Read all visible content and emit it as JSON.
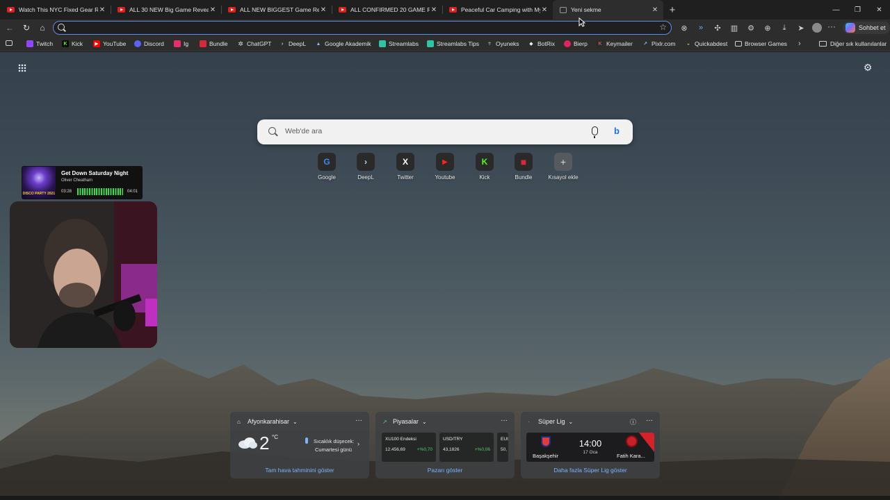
{
  "tabs": [
    {
      "title": "Watch This NYC Fixed Gear Rider C",
      "favicon": "youtube-icon"
    },
    {
      "title": "ALL 30 NEW Big Game Reveals fro",
      "favicon": "youtube-icon"
    },
    {
      "title": "ALL NEW BIGGEST Game Reveals o",
      "favicon": "youtube-icon"
    },
    {
      "title": "ALL CONFIRMED 20 GAME REMAK",
      "favicon": "youtube-icon"
    },
    {
      "title": "Peaceful Car Camping with My Do",
      "favicon": "youtube-icon"
    },
    {
      "title": "Yeni sekme",
      "favicon": "newtab-icon",
      "active": true
    }
  ],
  "toolbar": {
    "copilot_label": "Sohbet et"
  },
  "bookmarks": [
    {
      "label": "Twitch",
      "icon": "twitch-icon",
      "color": "#9146ff"
    },
    {
      "label": "Kick",
      "icon": "kick-icon",
      "color": "#53fc18"
    },
    {
      "label": "YouTube",
      "icon": "youtube-icon",
      "color": "#ff0000"
    },
    {
      "label": "Discord",
      "icon": "discord-icon",
      "color": "#5865f2"
    },
    {
      "label": "Ig",
      "icon": "instagram-icon",
      "color": "#e1306c"
    },
    {
      "label": "Bundle",
      "icon": "bundle-icon",
      "color": "#d62a3a"
    },
    {
      "label": "ChatGPT",
      "icon": "chatgpt-icon",
      "color": "#555555"
    },
    {
      "label": "DeepL",
      "icon": "deepl-icon",
      "color": "#0f2b46"
    },
    {
      "label": "Google Akademik",
      "icon": "scholar-icon",
      "color": "#4285f4"
    },
    {
      "label": "Streamlabs",
      "icon": "streamlabs-icon",
      "color": "#31c3a2"
    },
    {
      "label": "Streamlabs Tips",
      "icon": "streamlabs-icon",
      "color": "#31c3a2"
    },
    {
      "label": "Oyuneks",
      "icon": "oyuneks-icon",
      "color": "#888888"
    },
    {
      "label": "BotRix",
      "icon": "botrix-icon",
      "color": "#e6e6e6"
    },
    {
      "label": "Bierp",
      "icon": "bierp-icon",
      "color": "#e0245e"
    },
    {
      "label": "Keymailer",
      "icon": "keymailer-icon",
      "color": "#b0203a"
    },
    {
      "label": "Pixlr.com",
      "icon": "pixlr-icon",
      "color": "#3aa0ff"
    },
    {
      "label": "Quickabdest",
      "icon": "quickabdest-icon",
      "color": "#9acd32"
    },
    {
      "label": "Browser Games",
      "icon": "folder-icon",
      "color": "#cfcfcf"
    }
  ],
  "bookmarks_other": "Diğer sık kullanılanlar",
  "search": {
    "placeholder": "Web'de ara"
  },
  "quick_links": [
    {
      "label": "Google",
      "icon": "google-icon",
      "glyph": "G",
      "bg": "#2a2a2a",
      "fg": "#4285f4"
    },
    {
      "label": "DeepL",
      "icon": "deepl-icon",
      "glyph": ">",
      "bg": "#2a2a2a",
      "fg": "#cfd8e3"
    },
    {
      "label": "Twitter",
      "icon": "x-icon",
      "glyph": "X",
      "bg": "#2a2a2a",
      "fg": "#ffffff"
    },
    {
      "label": "Youtube",
      "icon": "youtube-icon",
      "glyph": "▶",
      "bg": "#2a2a2a",
      "fg": "#ff2020"
    },
    {
      "label": "Kick",
      "icon": "kick-icon",
      "glyph": "K",
      "bg": "#2a2a2a",
      "fg": "#53fc18"
    },
    {
      "label": "Bundle",
      "icon": "bundle-icon",
      "glyph": "■",
      "bg": "#2a2a2a",
      "fg": "#d62a3a"
    },
    {
      "label": "Kısayol ekle",
      "icon": "plus-icon",
      "glyph": "+",
      "bg": "#555a5e",
      "fg": "#d8d8d8"
    }
  ],
  "music": {
    "title": "Get Down Saturday Night",
    "artist": "Oliver Cheatham",
    "elapsed": "03:28",
    "duration": "04:01",
    "cover_text": "DISCO PARTY 2021"
  },
  "weather": {
    "location": "Afyonkarahisar",
    "temperature": "2",
    "unit": "°C",
    "alert_line1": "Sıcaklık düşecek:",
    "alert_line2": "Cumartesi günü",
    "link": "Tam hava tahminini göster"
  },
  "markets": {
    "title": "Piyasalar",
    "items": [
      {
        "name": "XU100 Endeksi",
        "value": "12.456,69",
        "change": "+%0,70"
      },
      {
        "name": "USD/TRY",
        "value": "43,1826",
        "change": "+%0,06"
      },
      {
        "name": "EUI",
        "value": "50,",
        "change": ""
      }
    ],
    "link": "Pazarı göster"
  },
  "league": {
    "title": "Süper Lig",
    "home": "Başakşehir",
    "away": "Fatih Kara...",
    "time": "14:00",
    "date": "17 Oca",
    "link": "Daha fazla Süper Lig göster"
  }
}
